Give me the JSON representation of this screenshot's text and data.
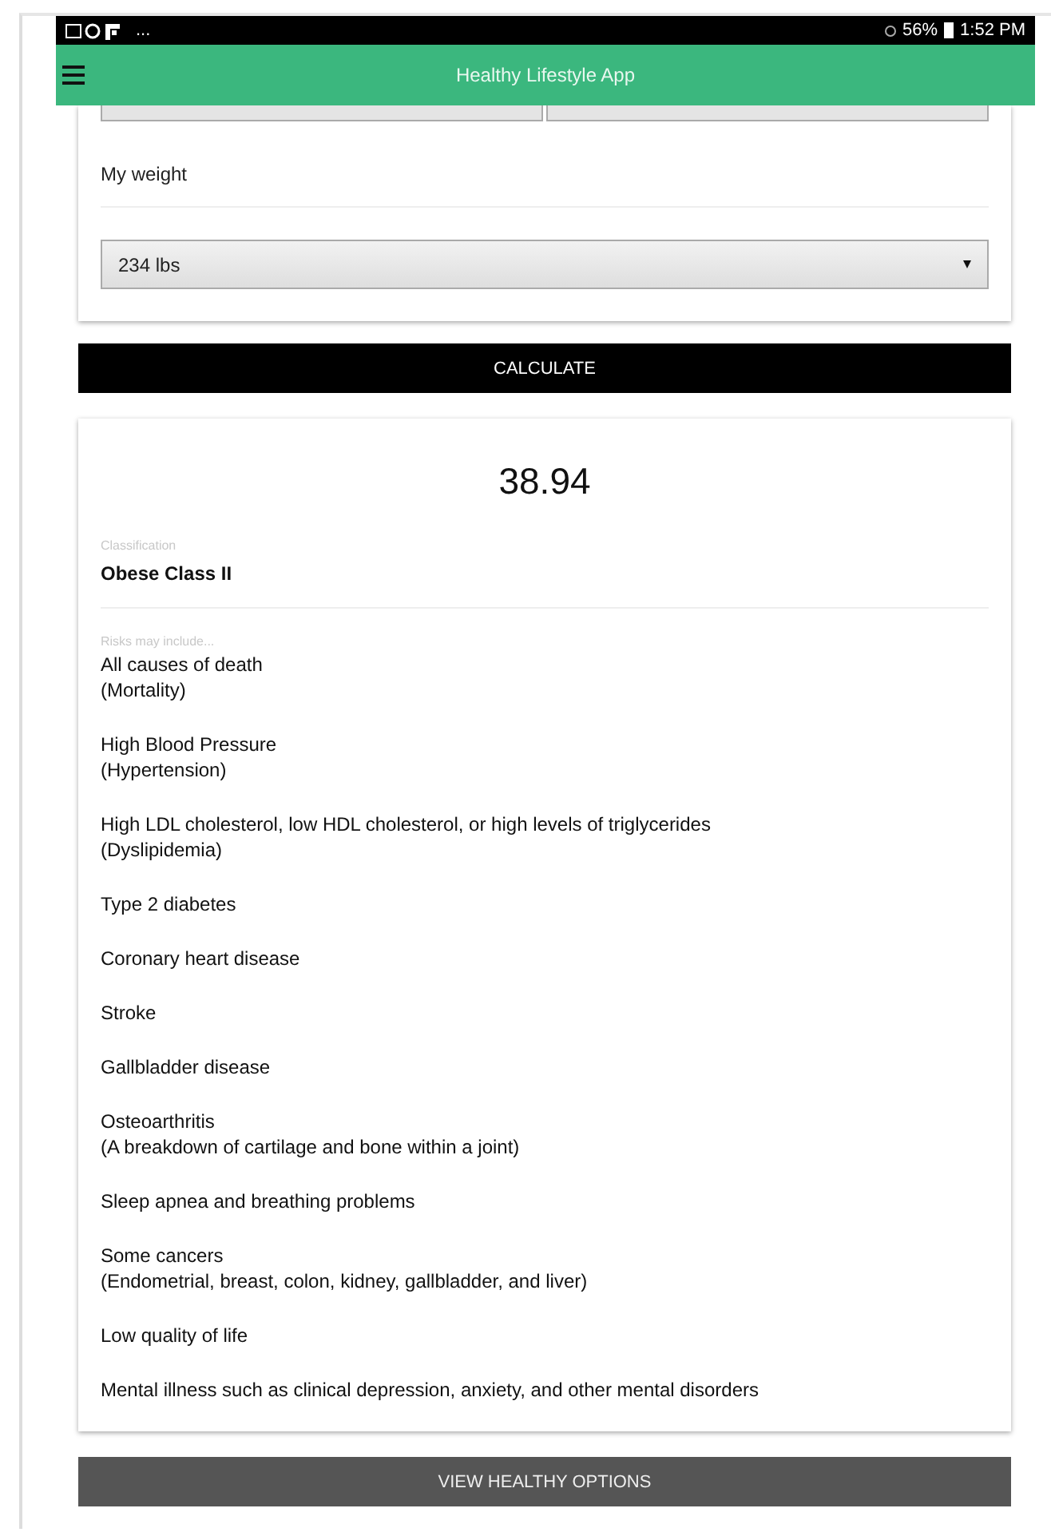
{
  "status_bar": {
    "overflow": "...",
    "battery": "56%",
    "time": "1:52 PM"
  },
  "app_bar": {
    "title": "Healthy Lifestyle App"
  },
  "form": {
    "weight_label": "My weight",
    "weight_value": "234 lbs"
  },
  "calculate_button": "CALCULATE",
  "result": {
    "bmi": "38.94",
    "classification_label": "Classification",
    "classification": "Obese Class II",
    "risks_label": "Risks may include...",
    "risks": [
      {
        "title": "All causes of death",
        "detail": "(Mortality)"
      },
      {
        "title": "High Blood Pressure",
        "detail": "(Hypertension)"
      },
      {
        "title": "High LDL cholesterol, low HDL cholesterol, or high levels of triglycerides",
        "detail": "(Dyslipidemia)"
      },
      {
        "title": "Type 2 diabetes"
      },
      {
        "title": "Coronary heart disease"
      },
      {
        "title": "Stroke"
      },
      {
        "title": "Gallbladder disease"
      },
      {
        "title": "Osteoarthritis",
        "detail": "(A breakdown of cartilage and bone within a joint)"
      },
      {
        "title": "Sleep apnea and breathing problems"
      },
      {
        "title": "Some cancers",
        "detail": "(Endometrial, breast, colon, kidney, gallbladder, and liver)"
      },
      {
        "title": "Low quality of life"
      },
      {
        "title": "Mental illness such as clinical depression, anxiety, and other mental disorders"
      }
    ]
  },
  "options_button": "VIEW HEALTHY OPTIONS"
}
